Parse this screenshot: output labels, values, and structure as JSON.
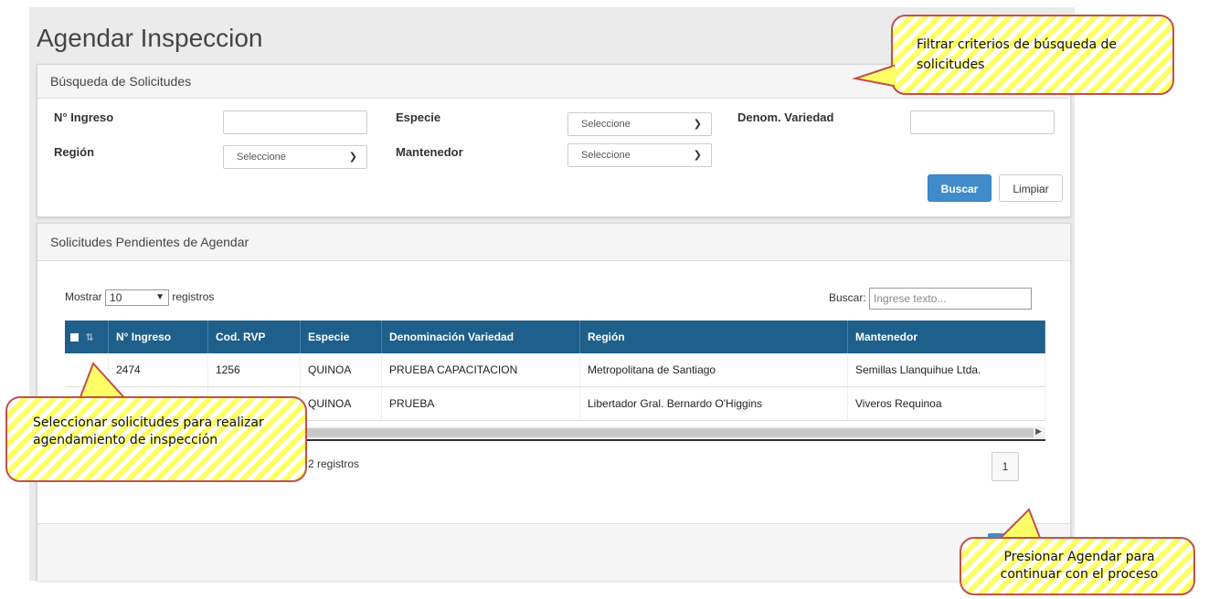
{
  "page": {
    "title": "Agendar Inspeccion"
  },
  "search_panel": {
    "heading": "Búsqueda de Solicitudes",
    "fields": {
      "ingreso_label": "N° Ingreso",
      "ingreso_value": "",
      "especie_label": "Especie",
      "especie_value": "Seleccione",
      "denom_label": "Denom. Variedad",
      "denom_value": "",
      "region_label": "Región",
      "region_value": "Seleccione",
      "mantenedor_label": "Mantenedor",
      "mantenedor_value": "Seleccione"
    },
    "buscar_label": "Buscar",
    "limpiar_label": "Limpiar"
  },
  "results_panel": {
    "heading": "Solicitudes Pendientes de Agendar",
    "show_prefix": "Mostrar",
    "show_value": "10",
    "show_suffix": "registros",
    "search_label": "Buscar:",
    "search_placeholder": "Ingrese texto...",
    "columns": [
      "N° Ingreso",
      "Cod. RVP",
      "Especie",
      "Denominación Variedad",
      "Región",
      "Mantenedor"
    ],
    "rows": [
      [
        "2474",
        "1256",
        "QUINOA",
        "PRUEBA CAPACITACION",
        "Metropolitana de Santiago",
        "Semillas Llanquihue Ltda."
      ],
      [
        "",
        "",
        "QUINOA",
        "PRUEBA",
        "Libertador Gral. Bernardo O'Higgins",
        "Viveros Requinoa"
      ]
    ],
    "info_text": "e 2 registros",
    "page_number": "1"
  },
  "callouts": {
    "filter": "Filtrar criterios de búsqueda de solicitudes",
    "select": "Seleccionar solicitudes para realizar agendamiento de inspección",
    "agendar": "Presionar Agendar para continuar con el proceso"
  },
  "colors": {
    "header_bg": "#1f5f8b",
    "primary_button": "#428bca",
    "callout_border": "#c0504d",
    "callout_fill": "#ffff66"
  }
}
